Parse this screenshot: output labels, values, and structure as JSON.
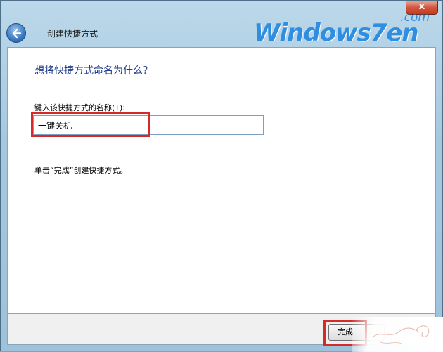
{
  "window": {
    "title": "创建快捷方式",
    "close_label": "x"
  },
  "watermark": {
    "main": "Windows7en",
    "suffix": ".com"
  },
  "content": {
    "heading": "想将快捷方式命名为什么？",
    "field_label": "键入该快捷方式的名称(T):",
    "input_value": "一键关机",
    "instruction": "单击“完成”创建快捷方式。"
  },
  "footer": {
    "finish_label": "完成"
  },
  "colors": {
    "highlight": "#d42a2a",
    "heading_text": "#1e3a8a"
  }
}
